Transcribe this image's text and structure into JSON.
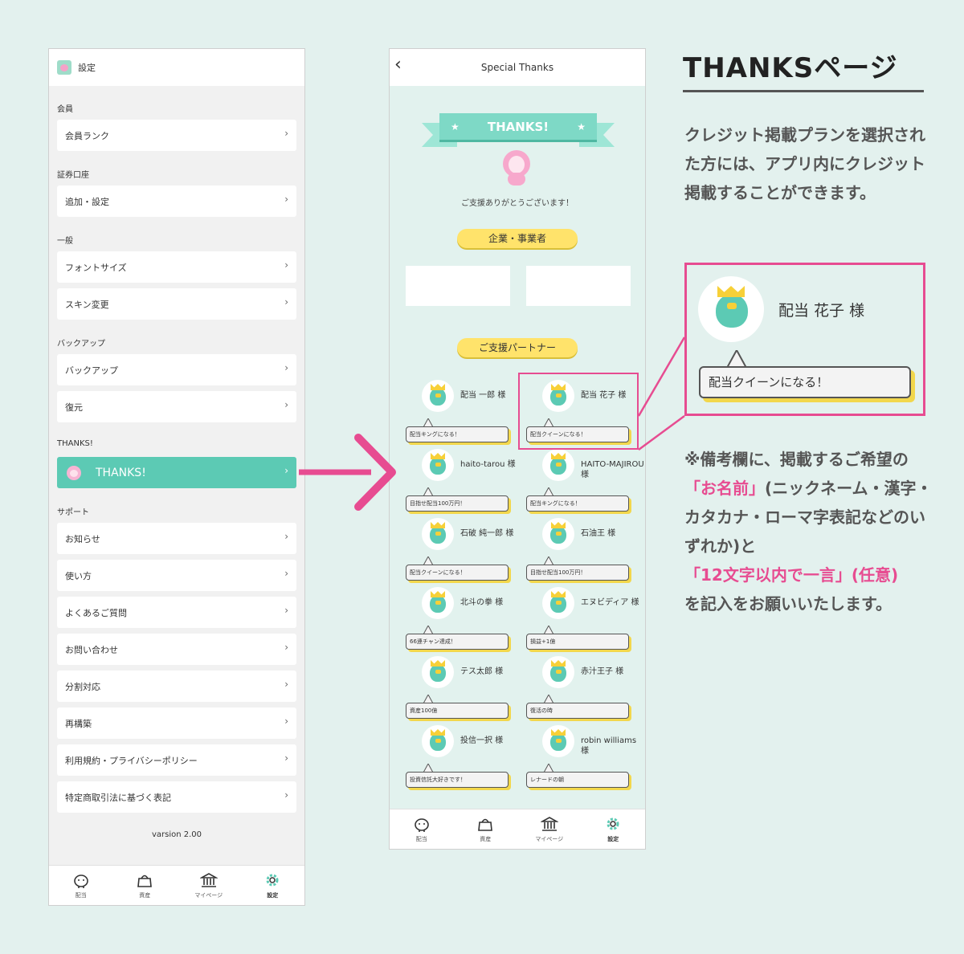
{
  "settings": {
    "header_title": "設定",
    "sections": [
      {
        "label": "会員",
        "items": [
          "会員ランク"
        ]
      },
      {
        "label": "証券口座",
        "items": [
          "追加・設定"
        ]
      },
      {
        "label": "一般",
        "items": [
          "フォントサイズ",
          "スキン変更"
        ]
      },
      {
        "label": "バックアップ",
        "items": [
          "バックアップ",
          "復元"
        ]
      },
      {
        "label": "THANKS!",
        "items": [
          "THANKS!"
        ]
      },
      {
        "label": "サポート",
        "items": [
          "お知らせ",
          "使い方",
          "よくあるご質問",
          "お問い合わせ",
          "分割対応",
          "再構築",
          "利用規約・プライバシーポリシー",
          "特定商取引法に基づく表記"
        ]
      }
    ],
    "version": "varsion 2.00",
    "active_item": "THANKS!"
  },
  "tabbar": {
    "tabs": [
      {
        "label": "配当",
        "icon": "piggy-bank-icon"
      },
      {
        "label": "資産",
        "icon": "purse-icon"
      },
      {
        "label": "マイページ",
        "icon": "bank-icon"
      },
      {
        "label": "設定",
        "icon": "gear-icon"
      }
    ],
    "active": "設定"
  },
  "thanks": {
    "header_title": "Special Thanks",
    "ribbon_text": "THANKS!",
    "support_message": "ご支援ありがとうございます！",
    "corporate_heading": "企業・事業者",
    "partner_heading": "ご支援パートナー",
    "partners": [
      {
        "name": "配当 一郎 様",
        "message": "配当キングになる！"
      },
      {
        "name": "配当 花子 様",
        "message": "配当クイーンになる！"
      },
      {
        "name": "haito-tarou 様",
        "message": "目指せ配当100万円！"
      },
      {
        "name": "HAITO-MAJIROU 様",
        "message": "配当キングになる！"
      },
      {
        "name": "石破 純一郎 様",
        "message": "配当クイーンになる！"
      },
      {
        "name": "石油王 様",
        "message": "目指せ配当100万円！"
      },
      {
        "name": "北斗の拳 様",
        "message": "66連チャン達成！"
      },
      {
        "name": "エヌビディア 様",
        "message": "損益+1億"
      },
      {
        "name": "テス太郎 様",
        "message": "資産100億"
      },
      {
        "name": "赤汁王子 様",
        "message": "復活の時"
      },
      {
        "name": "投信一択 様",
        "message": "投資信託大好きです！"
      },
      {
        "name": "robin williams 様",
        "message": "レナードの朝"
      }
    ]
  },
  "callout": {
    "name": "配当 花子 様",
    "message": "配当クイーンになる！"
  },
  "info": {
    "title": "THANKSページ",
    "description": "クレジット掲載プランを選択された方には、アプリ内にクレジット掲載することができます。",
    "note_1": "※備考欄に、掲載するご希望の",
    "note_name": "「お名前」",
    "note_2": "(ニックネーム・漢字・カタカナ・ローマ字表記などのいずれか)と",
    "note_msg": "「12文字以内で一言」(任意)",
    "note_3": "を記入をお願いいたします。"
  },
  "colors": {
    "accent": "#5ccab4",
    "highlight": "#e74c91",
    "pill": "#ffe36b",
    "background": "#e3f1ee"
  }
}
